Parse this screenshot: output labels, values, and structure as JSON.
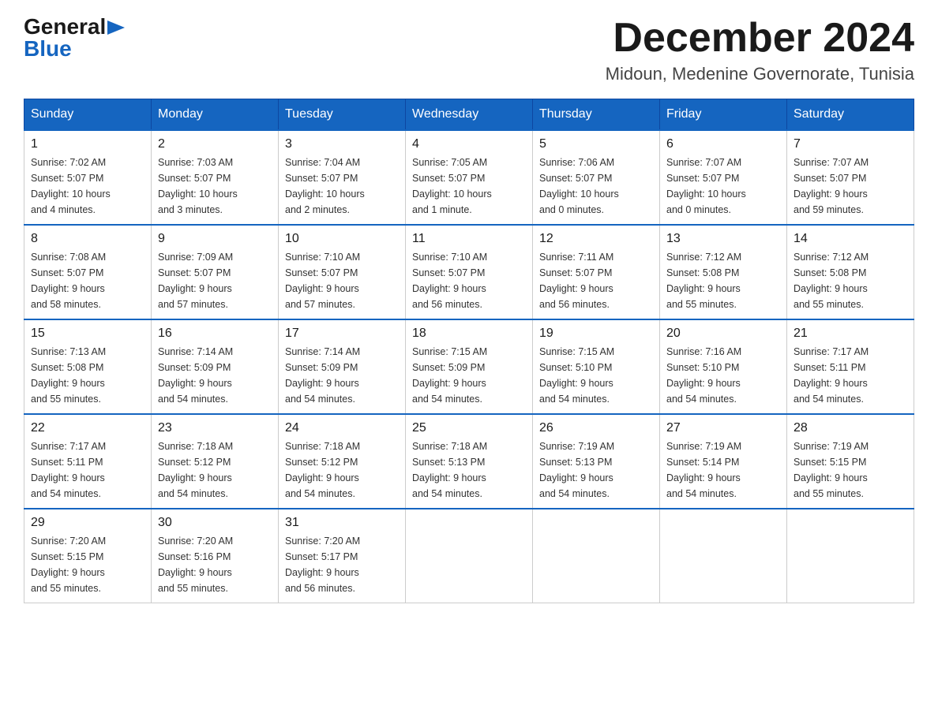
{
  "logo": {
    "general": "General",
    "blue": "Blue",
    "triangle": "▶"
  },
  "header": {
    "month_year": "December 2024",
    "location": "Midoun, Medenine Governorate, Tunisia"
  },
  "days_of_week": [
    "Sunday",
    "Monday",
    "Tuesday",
    "Wednesday",
    "Thursday",
    "Friday",
    "Saturday"
  ],
  "weeks": [
    [
      {
        "day": "1",
        "info": "Sunrise: 7:02 AM\nSunset: 5:07 PM\nDaylight: 10 hours\nand 4 minutes."
      },
      {
        "day": "2",
        "info": "Sunrise: 7:03 AM\nSunset: 5:07 PM\nDaylight: 10 hours\nand 3 minutes."
      },
      {
        "day": "3",
        "info": "Sunrise: 7:04 AM\nSunset: 5:07 PM\nDaylight: 10 hours\nand 2 minutes."
      },
      {
        "day": "4",
        "info": "Sunrise: 7:05 AM\nSunset: 5:07 PM\nDaylight: 10 hours\nand 1 minute."
      },
      {
        "day": "5",
        "info": "Sunrise: 7:06 AM\nSunset: 5:07 PM\nDaylight: 10 hours\nand 0 minutes."
      },
      {
        "day": "6",
        "info": "Sunrise: 7:07 AM\nSunset: 5:07 PM\nDaylight: 10 hours\nand 0 minutes."
      },
      {
        "day": "7",
        "info": "Sunrise: 7:07 AM\nSunset: 5:07 PM\nDaylight: 9 hours\nand 59 minutes."
      }
    ],
    [
      {
        "day": "8",
        "info": "Sunrise: 7:08 AM\nSunset: 5:07 PM\nDaylight: 9 hours\nand 58 minutes."
      },
      {
        "day": "9",
        "info": "Sunrise: 7:09 AM\nSunset: 5:07 PM\nDaylight: 9 hours\nand 57 minutes."
      },
      {
        "day": "10",
        "info": "Sunrise: 7:10 AM\nSunset: 5:07 PM\nDaylight: 9 hours\nand 57 minutes."
      },
      {
        "day": "11",
        "info": "Sunrise: 7:10 AM\nSunset: 5:07 PM\nDaylight: 9 hours\nand 56 minutes."
      },
      {
        "day": "12",
        "info": "Sunrise: 7:11 AM\nSunset: 5:07 PM\nDaylight: 9 hours\nand 56 minutes."
      },
      {
        "day": "13",
        "info": "Sunrise: 7:12 AM\nSunset: 5:08 PM\nDaylight: 9 hours\nand 55 minutes."
      },
      {
        "day": "14",
        "info": "Sunrise: 7:12 AM\nSunset: 5:08 PM\nDaylight: 9 hours\nand 55 minutes."
      }
    ],
    [
      {
        "day": "15",
        "info": "Sunrise: 7:13 AM\nSunset: 5:08 PM\nDaylight: 9 hours\nand 55 minutes."
      },
      {
        "day": "16",
        "info": "Sunrise: 7:14 AM\nSunset: 5:09 PM\nDaylight: 9 hours\nand 54 minutes."
      },
      {
        "day": "17",
        "info": "Sunrise: 7:14 AM\nSunset: 5:09 PM\nDaylight: 9 hours\nand 54 minutes."
      },
      {
        "day": "18",
        "info": "Sunrise: 7:15 AM\nSunset: 5:09 PM\nDaylight: 9 hours\nand 54 minutes."
      },
      {
        "day": "19",
        "info": "Sunrise: 7:15 AM\nSunset: 5:10 PM\nDaylight: 9 hours\nand 54 minutes."
      },
      {
        "day": "20",
        "info": "Sunrise: 7:16 AM\nSunset: 5:10 PM\nDaylight: 9 hours\nand 54 minutes."
      },
      {
        "day": "21",
        "info": "Sunrise: 7:17 AM\nSunset: 5:11 PM\nDaylight: 9 hours\nand 54 minutes."
      }
    ],
    [
      {
        "day": "22",
        "info": "Sunrise: 7:17 AM\nSunset: 5:11 PM\nDaylight: 9 hours\nand 54 minutes."
      },
      {
        "day": "23",
        "info": "Sunrise: 7:18 AM\nSunset: 5:12 PM\nDaylight: 9 hours\nand 54 minutes."
      },
      {
        "day": "24",
        "info": "Sunrise: 7:18 AM\nSunset: 5:12 PM\nDaylight: 9 hours\nand 54 minutes."
      },
      {
        "day": "25",
        "info": "Sunrise: 7:18 AM\nSunset: 5:13 PM\nDaylight: 9 hours\nand 54 minutes."
      },
      {
        "day": "26",
        "info": "Sunrise: 7:19 AM\nSunset: 5:13 PM\nDaylight: 9 hours\nand 54 minutes."
      },
      {
        "day": "27",
        "info": "Sunrise: 7:19 AM\nSunset: 5:14 PM\nDaylight: 9 hours\nand 54 minutes."
      },
      {
        "day": "28",
        "info": "Sunrise: 7:19 AM\nSunset: 5:15 PM\nDaylight: 9 hours\nand 55 minutes."
      }
    ],
    [
      {
        "day": "29",
        "info": "Sunrise: 7:20 AM\nSunset: 5:15 PM\nDaylight: 9 hours\nand 55 minutes."
      },
      {
        "day": "30",
        "info": "Sunrise: 7:20 AM\nSunset: 5:16 PM\nDaylight: 9 hours\nand 55 minutes."
      },
      {
        "day": "31",
        "info": "Sunrise: 7:20 AM\nSunset: 5:17 PM\nDaylight: 9 hours\nand 56 minutes."
      },
      {
        "day": "",
        "info": ""
      },
      {
        "day": "",
        "info": ""
      },
      {
        "day": "",
        "info": ""
      },
      {
        "day": "",
        "info": ""
      }
    ]
  ]
}
